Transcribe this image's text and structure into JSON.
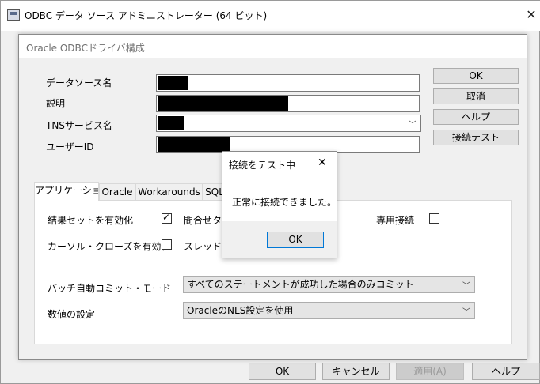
{
  "outer_window": {
    "title": "ODBC データ ソース アドミニストレーター (64 ビット)",
    "close_glyph": "✕",
    "buttons": {
      "ok": "OK",
      "cancel": "キャンセル",
      "apply": "適用(A)",
      "help": "ヘルプ"
    }
  },
  "dialog": {
    "title": "Oracle ODBCドライバ構成",
    "fields": {
      "dsn_label": "データソース名",
      "description_label": "説明",
      "tns_label": "TNSサービス名",
      "userid_label": "ユーザーID"
    },
    "side_buttons": {
      "ok": "OK",
      "cancel": "取消",
      "help": "ヘルプ",
      "test": "接続テスト"
    },
    "tabs": [
      "アプリケーション",
      "Oracle",
      "Workarounds",
      "SQL"
    ],
    "app_tab": {
      "result_sets_label": "結果セットを有効化",
      "query_timeout_label": "問合せタイ",
      "dedicated_label": "専用接続",
      "cursor_close_label": "カーソル・クローズを有効化",
      "thread_safe_label": "スレッドセー",
      "batch_commit_label": "バッチ自動コミット・モード",
      "batch_commit_value": "すべてのステートメントが成功した場合のみコミット",
      "numeric_label": "数値の設定",
      "numeric_value": "OracleのNLS設定を使用",
      "result_sets_checked": true,
      "cursor_close_checked": false,
      "dedicated_checked": false
    }
  },
  "popup": {
    "title": "接続をテスト中",
    "close_glyph": "✕",
    "message": "正常に接続できました。",
    "ok": "OK"
  }
}
